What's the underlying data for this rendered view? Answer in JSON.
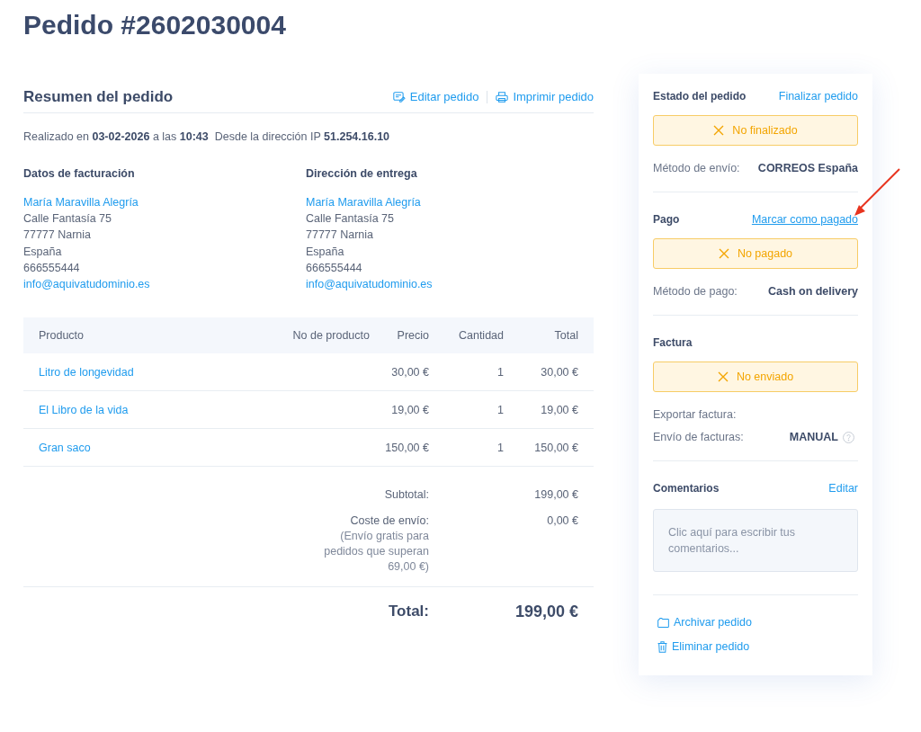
{
  "page": {
    "title": "Pedido #2602030004"
  },
  "summary": {
    "title": "Resumen del pedido",
    "actions": [
      "Editar pedido",
      "Imprimir pedido"
    ],
    "placed_info": "Realizado en **03-02-2026** a las **10:43**  Desde la dirección IP **51.254.16.10**",
    "addresses": [
      {
        "title": "Datos de facturación",
        "name": "María Maravilla Alegría",
        "lines": [
          "Calle Fantasía 75",
          "77777 Narnia",
          "España",
          "666555444"
        ],
        "email": "info@aquivatudominio.es"
      },
      {
        "title": "Dirección de entrega",
        "name": "María Maravilla Alegría",
        "lines": [
          "Calle Fantasía 75",
          "77777 Narnia",
          "España",
          "666555444"
        ],
        "email": "info@aquivatudominio.es"
      }
    ]
  },
  "table": {
    "columns": [
      "Producto",
      "No de producto",
      "Precio",
      "Cantidad",
      "Total"
    ],
    "rows": [
      {
        "product": "Litro de longevidad",
        "price": "30,00 €",
        "quantity": "1",
        "total": "30,00 €"
      },
      {
        "product": "El Libro de la vida",
        "price": "19,00 €",
        "quantity": "1",
        "total": "19,00 €"
      },
      {
        "product": "Gran saco",
        "price": "150,00 €",
        "quantity": "1",
        "total": "150,00 €"
      }
    ]
  },
  "totals": {
    "subtotal": {
      "label": "Subtotal:",
      "value": "199,00 €"
    },
    "shipping": {
      "label": "Coste de envío:",
      "note": "(Envío gratis para pedidos que superan 69,00 €)",
      "value": "0,00 €"
    },
    "total": {
      "label": "Total:",
      "value": "199,00 €"
    }
  },
  "sidebar": {
    "sections": [
      {
        "kind": "status",
        "title": "Estado del pedido",
        "action": {
          "label": "Finalizar pedido",
          "hovered": false
        },
        "status": "No finalizado",
        "done": false,
        "details": [
          {
            "label": "Método de envío:",
            "value": "CORREOS España",
            "help": false
          }
        ]
      },
      {
        "kind": "status",
        "title": "Pago",
        "action": {
          "label": "Marcar como pagado",
          "hovered": true
        },
        "status": "No pagado",
        "done": false,
        "details": [
          {
            "label": "Método de pago:",
            "value": "Cash on delivery",
            "help": false
          }
        ]
      },
      {
        "kind": "status",
        "title": "Factura",
        "status": "No enviado",
        "done": false,
        "details": [
          {
            "label": "Exportar factura:",
            "help": false
          },
          {
            "label": "Envío de facturas:",
            "value": "MANUAL",
            "help": true
          }
        ]
      },
      {
        "kind": "comments",
        "title": "Comentarios",
        "action": {
          "label": "Editar",
          "hovered": false
        },
        "placeholder": "Clic aquí para escribir tus comentarios..."
      }
    ],
    "footer_actions": [
      "Archivar pedido",
      "Eliminar pedido"
    ]
  }
}
